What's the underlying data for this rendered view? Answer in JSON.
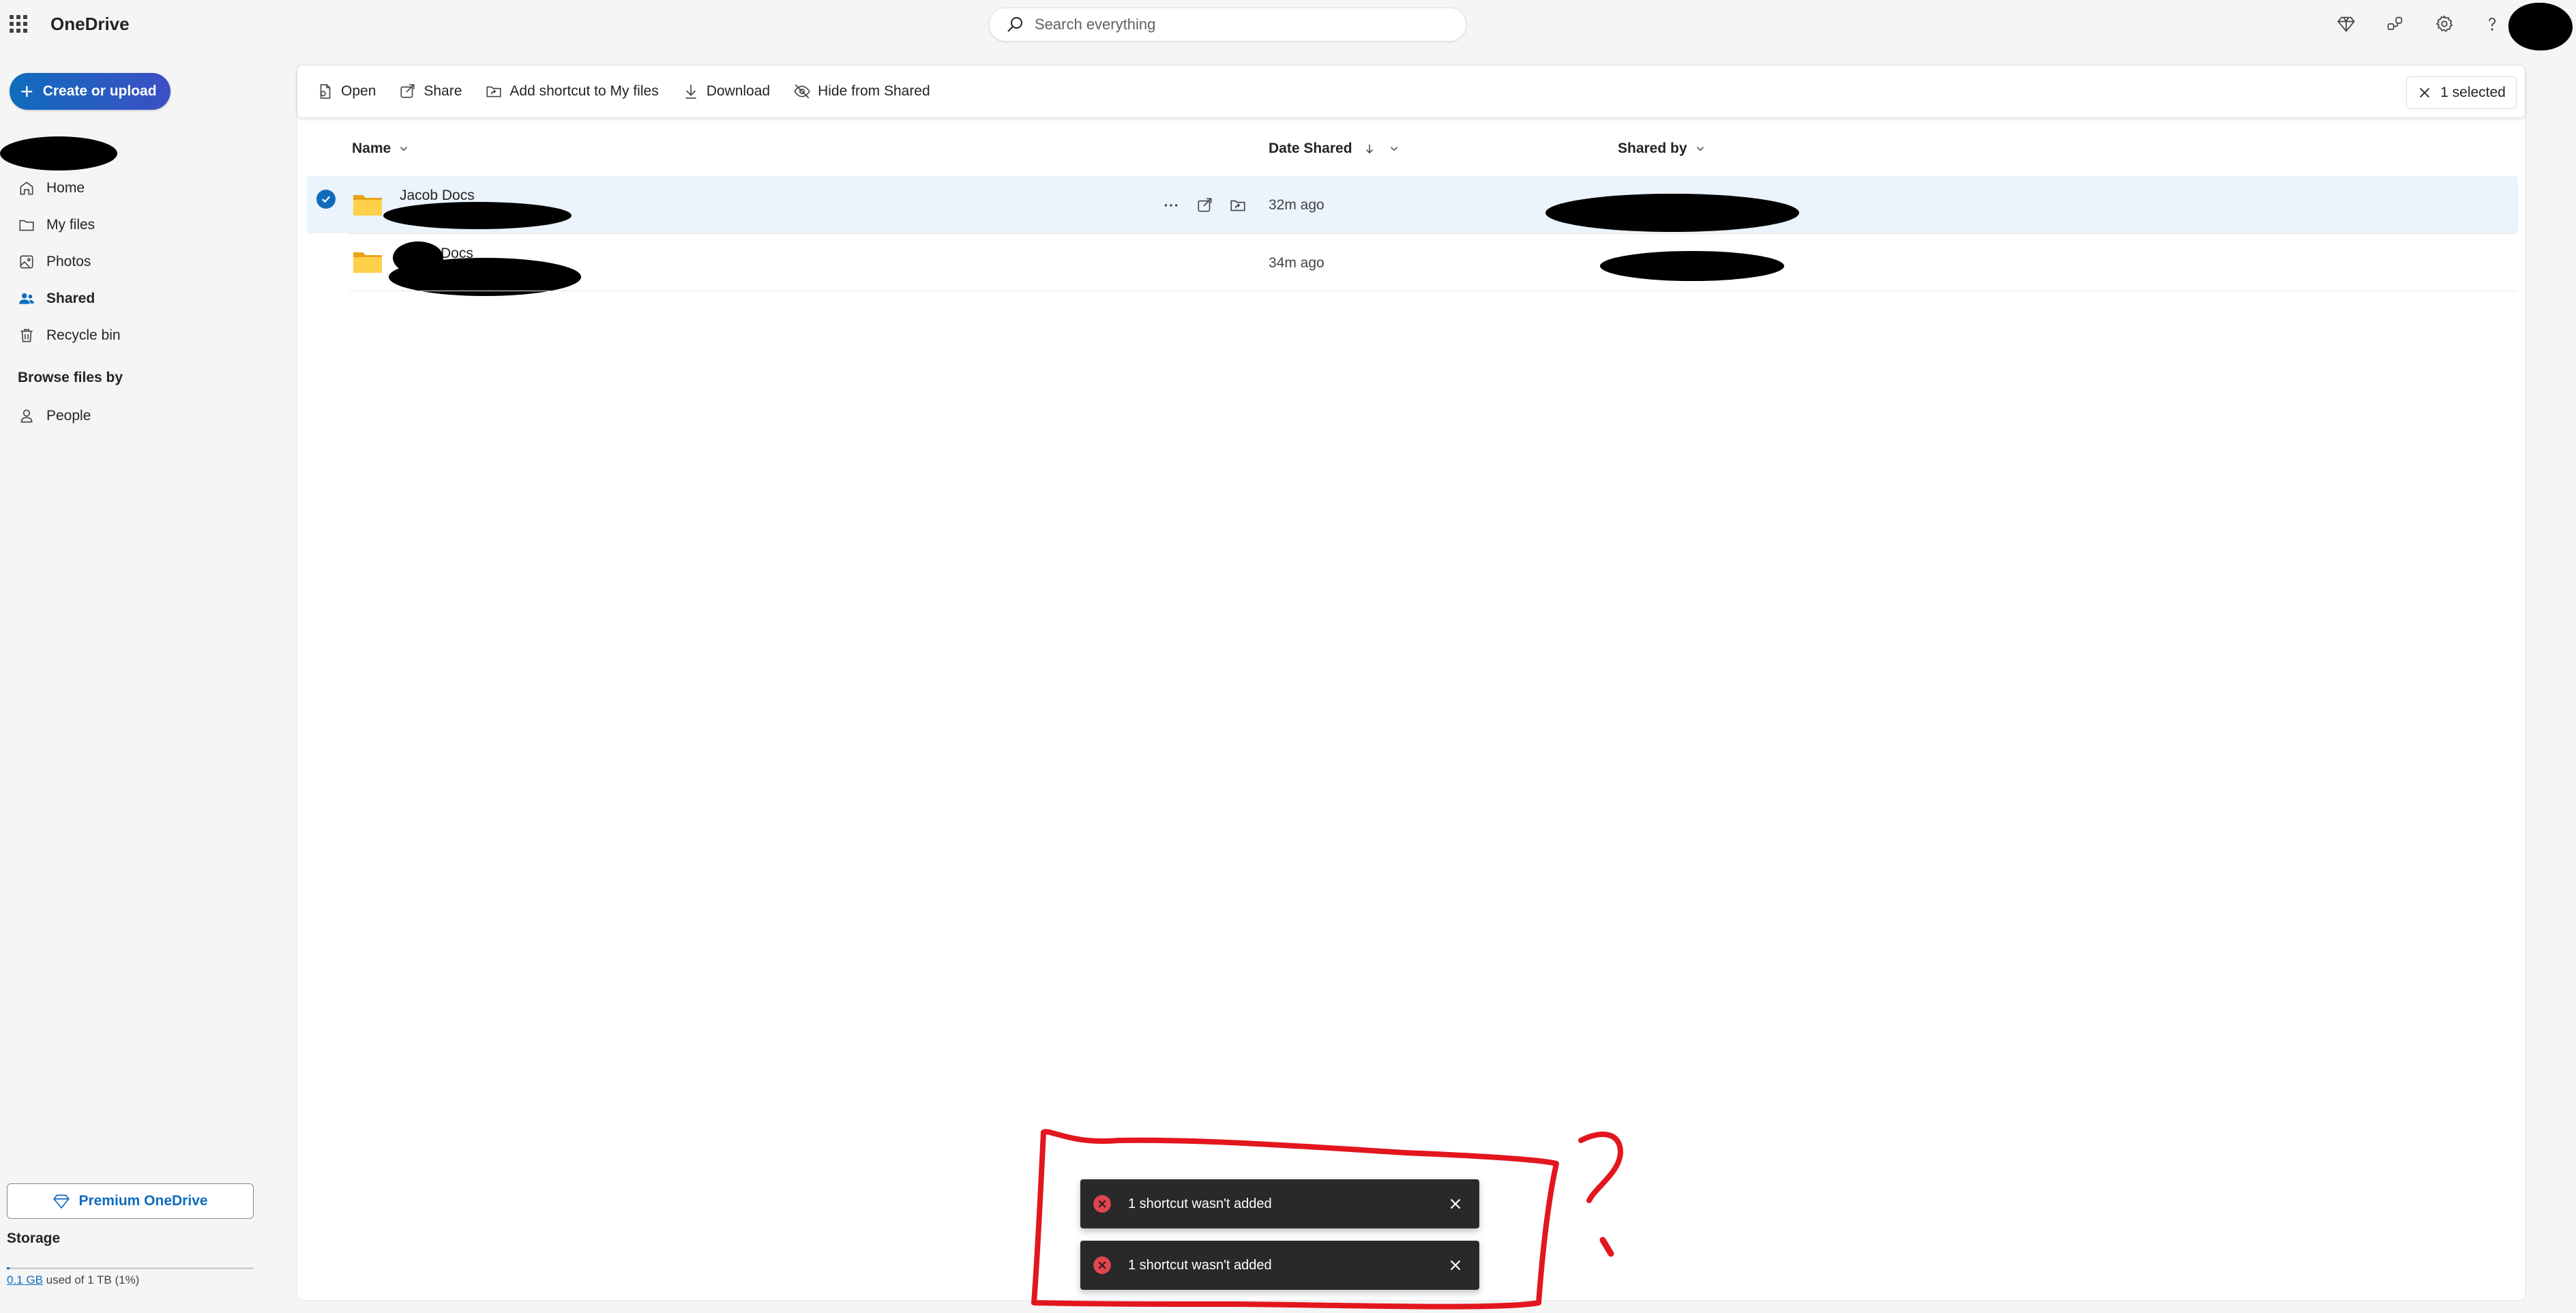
{
  "app": {
    "title": "OneDrive"
  },
  "search": {
    "placeholder": "Search everything"
  },
  "sidebar": {
    "create_label": "Create or upload",
    "items": [
      {
        "label": "Home",
        "icon": "home-icon"
      },
      {
        "label": "My files",
        "icon": "folder-icon"
      },
      {
        "label": "Photos",
        "icon": "photo-icon"
      },
      {
        "label": "Shared",
        "icon": "people-icon",
        "active": true
      },
      {
        "label": "Recycle bin",
        "icon": "trash-icon"
      }
    ],
    "browse_header": "Browse files by",
    "browse_items": [
      {
        "label": "People",
        "icon": "person-icon"
      }
    ],
    "premium_label": "Premium OneDrive",
    "storage": {
      "title": "Storage",
      "used": "0.1 GB",
      "rest": " used of 1 TB (1%)",
      "used_percent": 1
    }
  },
  "toolbar": {
    "open_label": "Open",
    "share_label": "Share",
    "add_shortcut_label": "Add shortcut to My files",
    "download_label": "Download",
    "hide_label": "Hide from Shared",
    "selected_label": "1 selected"
  },
  "table": {
    "columns": {
      "name": "Name",
      "date": "Date Shared",
      "shared_by": "Shared by"
    },
    "rows": [
      {
        "name": "Jacob Docs",
        "date": "32m ago",
        "selected": true
      },
      {
        "name": "Docs",
        "date": "34m ago",
        "selected": false
      }
    ]
  },
  "toasts": [
    {
      "message": "1 shortcut wasn't added"
    },
    {
      "message": "1 shortcut wasn't added"
    }
  ],
  "colors": {
    "accent": "#0f6cbd",
    "toast_bg": "#292929",
    "error": "#e0464d",
    "annotation": "#e3161e",
    "folder": "#ffd04a"
  }
}
